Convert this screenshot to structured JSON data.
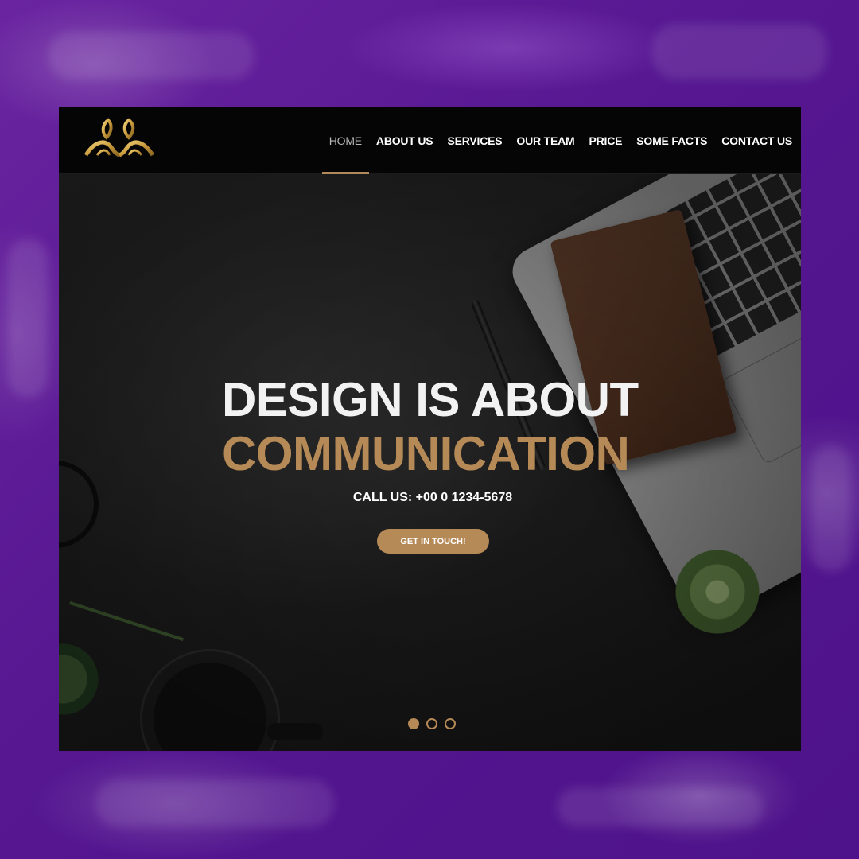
{
  "colors": {
    "accent": "#b58a57",
    "nav_background": "#050505",
    "backdrop": "#561791"
  },
  "brand": {
    "logo_icon": "leaf-crown-logo-icon"
  },
  "nav": {
    "items": [
      {
        "label": "HOME",
        "active": true
      },
      {
        "label": "ABOUT US",
        "active": false
      },
      {
        "label": "SERVICES",
        "active": false
      },
      {
        "label": "OUR TEAM",
        "active": false
      },
      {
        "label": "PRICE",
        "active": false
      },
      {
        "label": "SOME FACTS",
        "active": false
      },
      {
        "label": "CONTACT US",
        "active": false
      }
    ]
  },
  "hero": {
    "headline_line1": "DESIGN IS ABOUT",
    "headline_line2": "COMMUNICATION",
    "call_text": "CALL US: +00 0 1234-5678",
    "cta_label": "GET IN TOUCH!",
    "slides_total": 3,
    "active_slide": 1
  }
}
